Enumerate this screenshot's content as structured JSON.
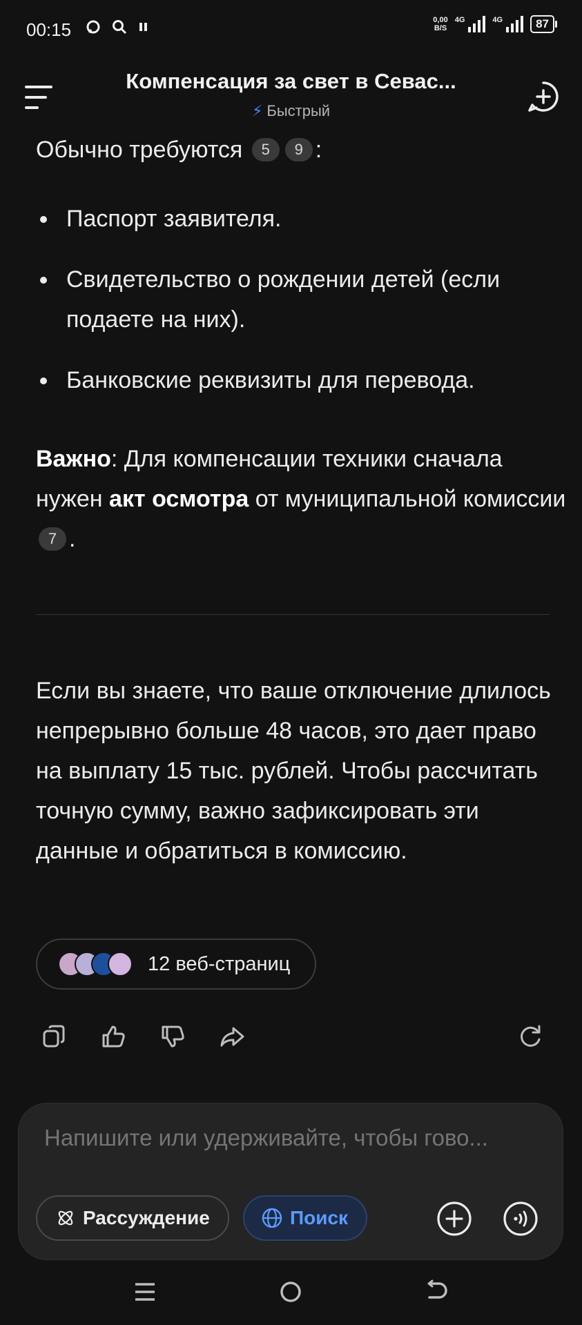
{
  "status_bar": {
    "time": "00:15",
    "net_speed_value": "0,00",
    "net_speed_unit": "B/S",
    "signal1_label": "4G",
    "signal2_label": "4G",
    "battery": "87"
  },
  "header": {
    "title": "Компенсация за свет в Севас...",
    "mode_label": "Быстрый"
  },
  "content": {
    "intro_text": "Обычно требуются",
    "intro_citations": [
      "5",
      "9"
    ],
    "bullets": [
      "Паспорт заявителя.",
      "Свидетельство о рождении детей (если подаете на них).",
      "Банковские реквизиты для перевода."
    ],
    "important": {
      "label": "Важно",
      "text1": ": Для компенсации техники сначала нужен ",
      "bold": "акт осмотра",
      "text2": " от муниципальной комиссии",
      "citation": "7"
    },
    "paragraph": "Если вы знаете, что ваше отключение длилось непрерывно больше 48 часов, это дает право на выплату 15 тыс. рублей. Чтобы рассчитать точную сумму, важно зафиксировать эти данные и обратиться в комиссию."
  },
  "sources": {
    "label": "12 веб-страниц",
    "favicon_colors": [
      "#c9a7c9",
      "#b8b0d8",
      "#1e4f9c",
      "#d2b6e0"
    ]
  },
  "actions": [
    "copy-icon",
    "thumbs-up-icon",
    "thumbs-down-icon",
    "share-icon",
    "regenerate-icon"
  ],
  "composer": {
    "placeholder": "Напишите или удерживайте, чтобы гово...",
    "reasoning_label": "Рассуждение",
    "search_label": "Поиск"
  },
  "colors": {
    "background": "#121212",
    "accent": "#3f8cff",
    "search_chip_bg": "#1d2a45"
  }
}
